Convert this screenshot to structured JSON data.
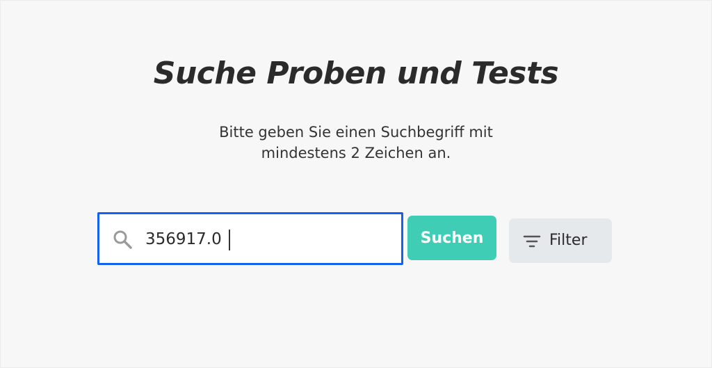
{
  "header": {
    "title": "Suche Proben und Tests",
    "subtitle_line1": "Bitte geben Sie einen Suchbegriff mit",
    "subtitle_line2": "mindestens 2 Zeichen an."
  },
  "search": {
    "value": "356917.0",
    "icon": "search-icon",
    "focus_color": "#1560f0"
  },
  "actions": {
    "search_label": "Suchen",
    "search_color": "#3fcdb5",
    "filter_label": "Filter",
    "filter_icon": "filter-icon",
    "filter_color": "#e5e9ec"
  }
}
